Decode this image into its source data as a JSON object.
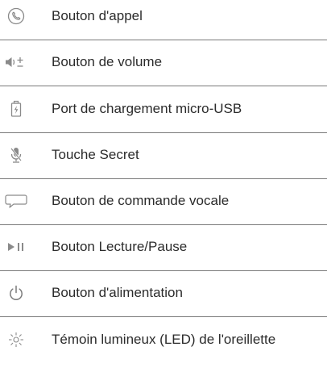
{
  "items": [
    {
      "icon": "phone-icon",
      "label": "Bouton d'appel"
    },
    {
      "icon": "volume-icon",
      "label": "Bouton de volume"
    },
    {
      "icon": "charging-port-icon",
      "label": "Port de chargement micro-USB"
    },
    {
      "icon": "mute-microphone-icon",
      "label": "Touche Secret"
    },
    {
      "icon": "speech-bubble-icon",
      "label": "Bouton de commande vocale"
    },
    {
      "icon": "play-pause-icon",
      "label": "Bouton Lecture/Pause"
    },
    {
      "icon": "power-icon",
      "label": "Bouton d'alimentation"
    },
    {
      "icon": "led-indicator-icon",
      "label": "Témoin lumineux (LED) de l'oreillette"
    }
  ],
  "colors": {
    "text": "#2b2b2b",
    "icon": "#8a8a8a",
    "divider": "#7a7a7a"
  }
}
